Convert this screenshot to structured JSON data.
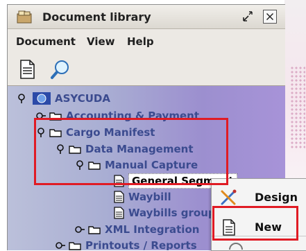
{
  "window": {
    "title": "Document library"
  },
  "menu": {
    "items": [
      "Document",
      "View",
      "Help"
    ]
  },
  "toolbar": {
    "tools": [
      "new-document",
      "search"
    ]
  },
  "tree": {
    "root": "ASYCUDA",
    "accounting": "Accounting & Payment",
    "cargo_manifest": "Cargo Manifest",
    "data_management": "Data Management",
    "manual_capture": "Manual Capture",
    "general_segment": "General Segment",
    "waybill": "Waybill",
    "waybills_group": "Waybills groupa",
    "xml_integration": "XML Integration",
    "printouts": "Printouts / Reports"
  },
  "context_menu": {
    "design": "Design",
    "new": "New"
  },
  "colors": {
    "highlight_box": "#e01b24",
    "tree_text": "#3b4b8f"
  }
}
